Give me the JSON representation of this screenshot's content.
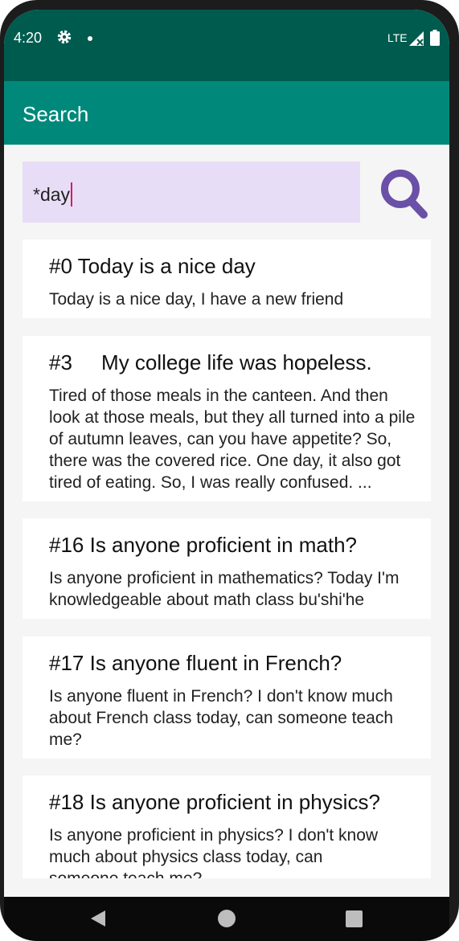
{
  "status_bar": {
    "time": "4:20",
    "network": "LTE",
    "icons": [
      "gear-icon",
      "notification-dot-icon",
      "signal-icon",
      "battery-icon"
    ]
  },
  "app_bar": {
    "title": "Search"
  },
  "search": {
    "value": "*day",
    "button_icon": "search-icon"
  },
  "results": [
    {
      "title": "#0 Today is a nice day",
      "body": "Today is a nice day, I have a new friend"
    },
    {
      "title": "#3     My college life was hopeless.",
      "body": "Tired of those meals in the canteen. And then look at those meals, but they all turned into a pile of autumn leaves, can you have appetite? So, there was the covered rice. One day, it also got tired of eating. So, I was really confused. ..."
    },
    {
      "title": "#16 Is anyone proficient in math?",
      "body": "Is anyone proficient in mathematics? Today I'm knowledgeable about math class bu'shi'he"
    },
    {
      "title": "#17 Is anyone fluent in French?",
      "body": "Is anyone fluent in French? I don't know much about French class today, can someone teach me?"
    },
    {
      "title": "#18 Is anyone proficient in physics?",
      "body": "Is anyone proficient in physics? I don't know much about physics class today, can someone teach me?"
    }
  ],
  "colors": {
    "status_bar": "#005b4f",
    "app_bar": "#00897b",
    "search_field": "#e8ddf6",
    "search_icon": "#6a50a7",
    "caret": "#d81b60"
  }
}
